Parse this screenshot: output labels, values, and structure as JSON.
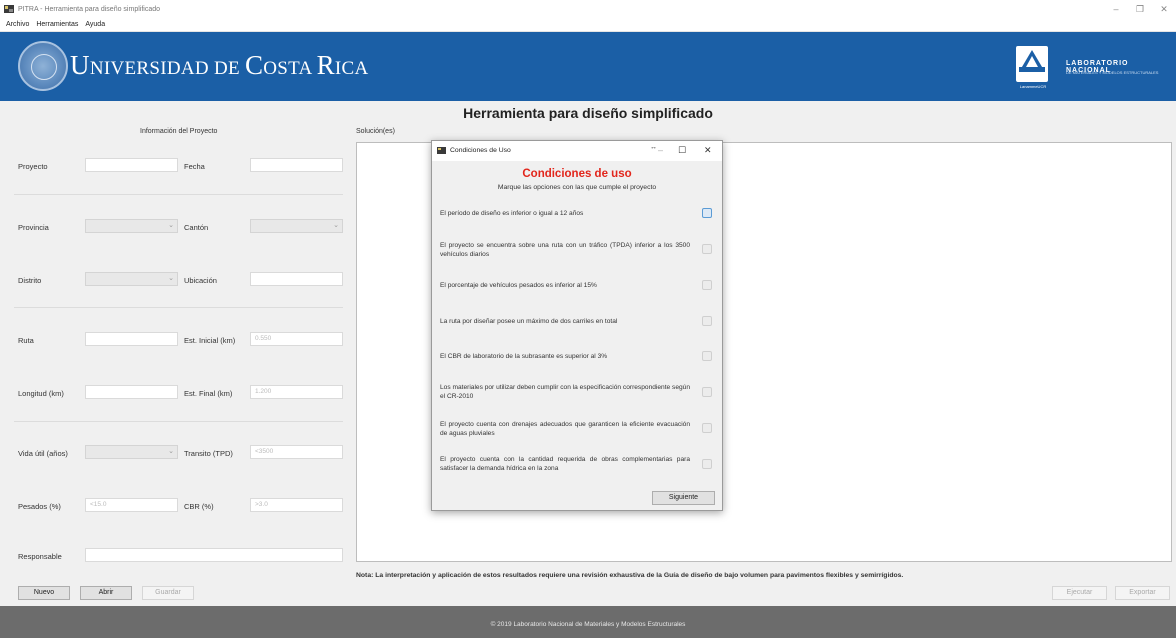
{
  "window": {
    "title": "PITRA - Herramienta para diseño simplificado"
  },
  "menu": [
    "Archivo",
    "Herramientas",
    "Ayuda"
  ],
  "banner": {
    "university_a": "U",
    "university_b": "NIVERSIDAD DE ",
    "university_c": "C",
    "university_d": "OSTA ",
    "university_e": "R",
    "university_f": "ICA",
    "lab_name": "LABORATORIO NACIONAL",
    "lab_sub": "DE MATERIALES Y MODELOS ESTRUCTURALES",
    "lab_logo_text": "LanammeUCR"
  },
  "main_title": "Herramienta para diseño simplificado",
  "project_info_title": "Información del Proyecto",
  "solutions_label": "Solución(es)",
  "form": {
    "proyecto": "Proyecto",
    "fecha": "Fecha",
    "provincia": "Provincia",
    "canton": "Cantón",
    "distrito": "Distrito",
    "ubicacion": "Ubicación",
    "ruta": "Ruta",
    "est_inicial": "Est. Inicial (km)",
    "est_inicial_ph": "0.550",
    "longitud": "Longitud (km)",
    "est_final": "Est. Final (km)",
    "est_final_ph": "1.200",
    "vida_util": "Vida útil (años)",
    "transito": "Transito (TPD)",
    "transito_ph": "<3500",
    "pesados": "Pesados (%)",
    "pesados_ph": "<15.0",
    "cbr": "CBR (%)",
    "cbr_ph": ">3.0",
    "responsable": "Responsable"
  },
  "note": "Nota: La interpretación y aplicación de estos resultados requiere una revisión exhaustiva de la Guía de diseño de bajo volumen para pavimentos flexibles y semirrígidos.",
  "buttons": {
    "nuevo": "Nuevo",
    "abrir": "Abrir",
    "guardar": "Guardar",
    "ejecutar": "Ejecutar",
    "exportar": "Exportar"
  },
  "footer": "© 2019 Laboratorio Nacional de Materiales y Modelos Estructurales",
  "dialog": {
    "title": "Condiciones de Uso",
    "heading": "Condiciones de uso",
    "subtitle": "Marque las opciones con las que cumple el proyecto",
    "conditions": [
      "El período de diseño es inferior o igual a 12 años",
      "El proyecto se encuentra sobre una ruta con un tráfico (TPDA) inferior a los 3500 vehículos diarios",
      "El porcentaje de vehículos pesados es inferior al 15%",
      "La ruta por diseñar posee un máximo de dos carriles en total",
      "El CBR de laboratorio de la subrasante es superior al 3%",
      "Los materiales por utilizar deben cumplir con la especificación correspondiente según el CR-2010",
      "El proyecto cuenta con drenajes adecuados que garanticen la eficiente evacuación de aguas pluviales",
      "El proyecto cuenta con la cantidad requerida de obras complementarias para satisfacer la demanda hídrica en la zona"
    ],
    "next": "Siguiente"
  }
}
